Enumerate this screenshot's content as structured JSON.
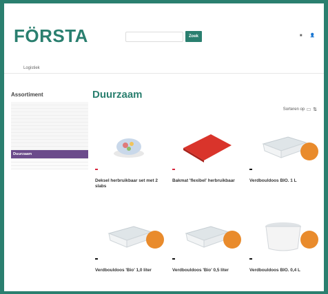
{
  "header": {
    "logo": "FÖRSTA",
    "search_placeholder": "",
    "search_button": "Zoek",
    "account_label": "",
    "login_label": ""
  },
  "nav": {
    "items": [
      "",
      "",
      "Logistiek",
      "",
      "",
      "",
      ""
    ]
  },
  "sidebar": {
    "title": "Assortiment",
    "items": [
      {
        "label": "",
        "active": false,
        "sub": false
      },
      {
        "label": "",
        "active": false,
        "sub": false
      },
      {
        "label": "",
        "active": false,
        "sub": false
      },
      {
        "label": "",
        "active": false,
        "sub": false
      },
      {
        "label": "",
        "active": false,
        "sub": false
      },
      {
        "label": "",
        "active": false,
        "sub": false
      },
      {
        "label": "",
        "active": false,
        "sub": false
      },
      {
        "label": "",
        "active": false,
        "sub": false
      },
      {
        "label": "",
        "active": false,
        "sub": false
      },
      {
        "label": "",
        "active": false,
        "sub": false
      },
      {
        "label": "",
        "active": false,
        "sub": false
      },
      {
        "label": "",
        "active": false,
        "sub": false
      },
      {
        "label": "",
        "active": false,
        "sub": false
      },
      {
        "label": "",
        "active": false,
        "sub": false
      },
      {
        "label": "Duurzaam",
        "active": true,
        "sub": false
      },
      {
        "label": "",
        "active": false,
        "sub": true
      },
      {
        "label": "",
        "active": false,
        "sub": true
      },
      {
        "label": "",
        "active": false,
        "sub": true
      }
    ]
  },
  "main": {
    "title": "Duurzaam",
    "sort_label": "Sorteren op",
    "sort_value": ""
  },
  "products": [
    {
      "name": "Deksel herbruikbaar set met 2 slabs",
      "brand": "",
      "brand_color": "#d7263d",
      "price": "",
      "image": "bowl"
    },
    {
      "name": "Bakmat 'flexibel' herbruikbaar",
      "brand": "",
      "brand_color": "#d7263d",
      "price": "",
      "image": "mat"
    },
    {
      "name": "Verdbouldoos BIO. 1 L",
      "brand": "",
      "brand_color": "#111111",
      "price": "",
      "image": "tray"
    },
    {
      "name": "Verdbouldoos 'Bio' 1,0 liter",
      "brand": "",
      "brand_color": "#111111",
      "price": "",
      "image": "tray2"
    },
    {
      "name": "Verdbouldoos 'Bio' 0,5 liter",
      "brand": "",
      "brand_color": "#111111",
      "price": "",
      "image": "tray3"
    },
    {
      "name": "Verdbouldoos BIO. 0,4 L",
      "brand": "",
      "brand_color": "#111111",
      "price": "",
      "image": "cup"
    }
  ],
  "colors": {
    "accent": "#2a7f6f",
    "active_category": "#6b4b8b",
    "price_badge": "#e98b2c"
  }
}
